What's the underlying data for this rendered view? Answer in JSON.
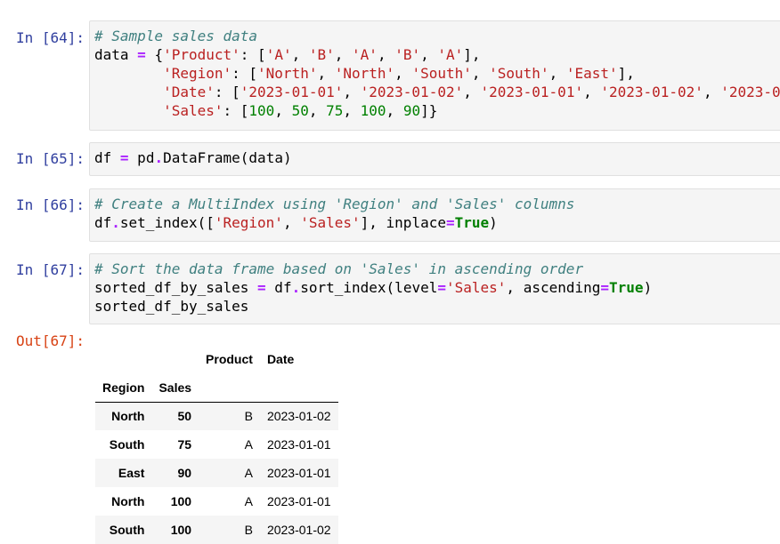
{
  "cells": [
    {
      "prompt": "In [64]:",
      "lines": [
        [
          {
            "t": "# Sample sales data",
            "c": "comment"
          }
        ],
        [
          {
            "t": "data "
          },
          {
            "t": "=",
            "c": "op"
          },
          {
            "t": " {"
          },
          {
            "t": "'Product'",
            "c": "str"
          },
          {
            "t": ": ["
          },
          {
            "t": "'A'",
            "c": "str"
          },
          {
            "t": ", "
          },
          {
            "t": "'B'",
            "c": "str"
          },
          {
            "t": ", "
          },
          {
            "t": "'A'",
            "c": "str"
          },
          {
            "t": ", "
          },
          {
            "t": "'B'",
            "c": "str"
          },
          {
            "t": ", "
          },
          {
            "t": "'A'",
            "c": "str"
          },
          {
            "t": "],"
          }
        ],
        [
          {
            "t": "        "
          },
          {
            "t": "'Region'",
            "c": "str"
          },
          {
            "t": ": ["
          },
          {
            "t": "'North'",
            "c": "str"
          },
          {
            "t": ", "
          },
          {
            "t": "'North'",
            "c": "str"
          },
          {
            "t": ", "
          },
          {
            "t": "'South'",
            "c": "str"
          },
          {
            "t": ", "
          },
          {
            "t": "'South'",
            "c": "str"
          },
          {
            "t": ", "
          },
          {
            "t": "'East'",
            "c": "str"
          },
          {
            "t": "],"
          }
        ],
        [
          {
            "t": "        "
          },
          {
            "t": "'Date'",
            "c": "str"
          },
          {
            "t": ": ["
          },
          {
            "t": "'2023-01-01'",
            "c": "str"
          },
          {
            "t": ", "
          },
          {
            "t": "'2023-01-02'",
            "c": "str"
          },
          {
            "t": ", "
          },
          {
            "t": "'2023-01-01'",
            "c": "str"
          },
          {
            "t": ", "
          },
          {
            "t": "'2023-01-02'",
            "c": "str"
          },
          {
            "t": ", "
          },
          {
            "t": "'2023-0",
            "c": "str"
          }
        ],
        [
          {
            "t": "        "
          },
          {
            "t": "'Sales'",
            "c": "str"
          },
          {
            "t": ": ["
          },
          {
            "t": "100",
            "c": "num"
          },
          {
            "t": ", "
          },
          {
            "t": "50",
            "c": "num"
          },
          {
            "t": ", "
          },
          {
            "t": "75",
            "c": "num"
          },
          {
            "t": ", "
          },
          {
            "t": "100",
            "c": "num"
          },
          {
            "t": ", "
          },
          {
            "t": "90",
            "c": "num"
          },
          {
            "t": "]}"
          }
        ]
      ]
    },
    {
      "prompt": "In [65]:",
      "lines": [
        [
          {
            "t": "df "
          },
          {
            "t": "=",
            "c": "op"
          },
          {
            "t": " pd"
          },
          {
            "t": ".",
            "c": "op"
          },
          {
            "t": "DataFrame(data)"
          }
        ]
      ]
    },
    {
      "prompt": "In [66]:",
      "lines": [
        [
          {
            "t": "# Create a MultiIndex using 'Region' and 'Sales' columns",
            "c": "comment"
          }
        ],
        [
          {
            "t": "df"
          },
          {
            "t": ".",
            "c": "op"
          },
          {
            "t": "set_index(["
          },
          {
            "t": "'Region'",
            "c": "str"
          },
          {
            "t": ", "
          },
          {
            "t": "'Sales'",
            "c": "str"
          },
          {
            "t": "], inplace"
          },
          {
            "t": "=",
            "c": "op"
          },
          {
            "t": "True",
            "c": "kw"
          },
          {
            "t": ")"
          }
        ]
      ]
    },
    {
      "prompt": "In [67]:",
      "lines": [
        [
          {
            "t": "# Sort the data frame based on 'Sales' in ascending order",
            "c": "comment"
          }
        ],
        [
          {
            "t": "sorted_df_by_sales "
          },
          {
            "t": "=",
            "c": "op"
          },
          {
            "t": " df"
          },
          {
            "t": ".",
            "c": "op"
          },
          {
            "t": "sort_index(level"
          },
          {
            "t": "=",
            "c": "op"
          },
          {
            "t": "'Sales'",
            "c": "str"
          },
          {
            "t": ", ascending"
          },
          {
            "t": "=",
            "c": "op"
          },
          {
            "t": "True",
            "c": "kw"
          },
          {
            "t": ")"
          }
        ],
        [
          {
            "t": "sorted_df_by_sales"
          }
        ]
      ]
    }
  ],
  "output": {
    "prompt": "Out[67]:",
    "columns": [
      "Product",
      "Date"
    ],
    "index_names": [
      "Region",
      "Sales"
    ],
    "rows": [
      {
        "region": "North",
        "sales": "50",
        "product": "B",
        "date": "2023-01-02"
      },
      {
        "region": "South",
        "sales": "75",
        "product": "A",
        "date": "2023-01-01"
      },
      {
        "region": "East",
        "sales": "90",
        "product": "A",
        "date": "2023-01-01"
      },
      {
        "region": "North",
        "sales": "100",
        "product": "A",
        "date": "2023-01-01"
      },
      {
        "region": "South",
        "sales": "100",
        "product": "B",
        "date": "2023-01-02"
      }
    ]
  }
}
